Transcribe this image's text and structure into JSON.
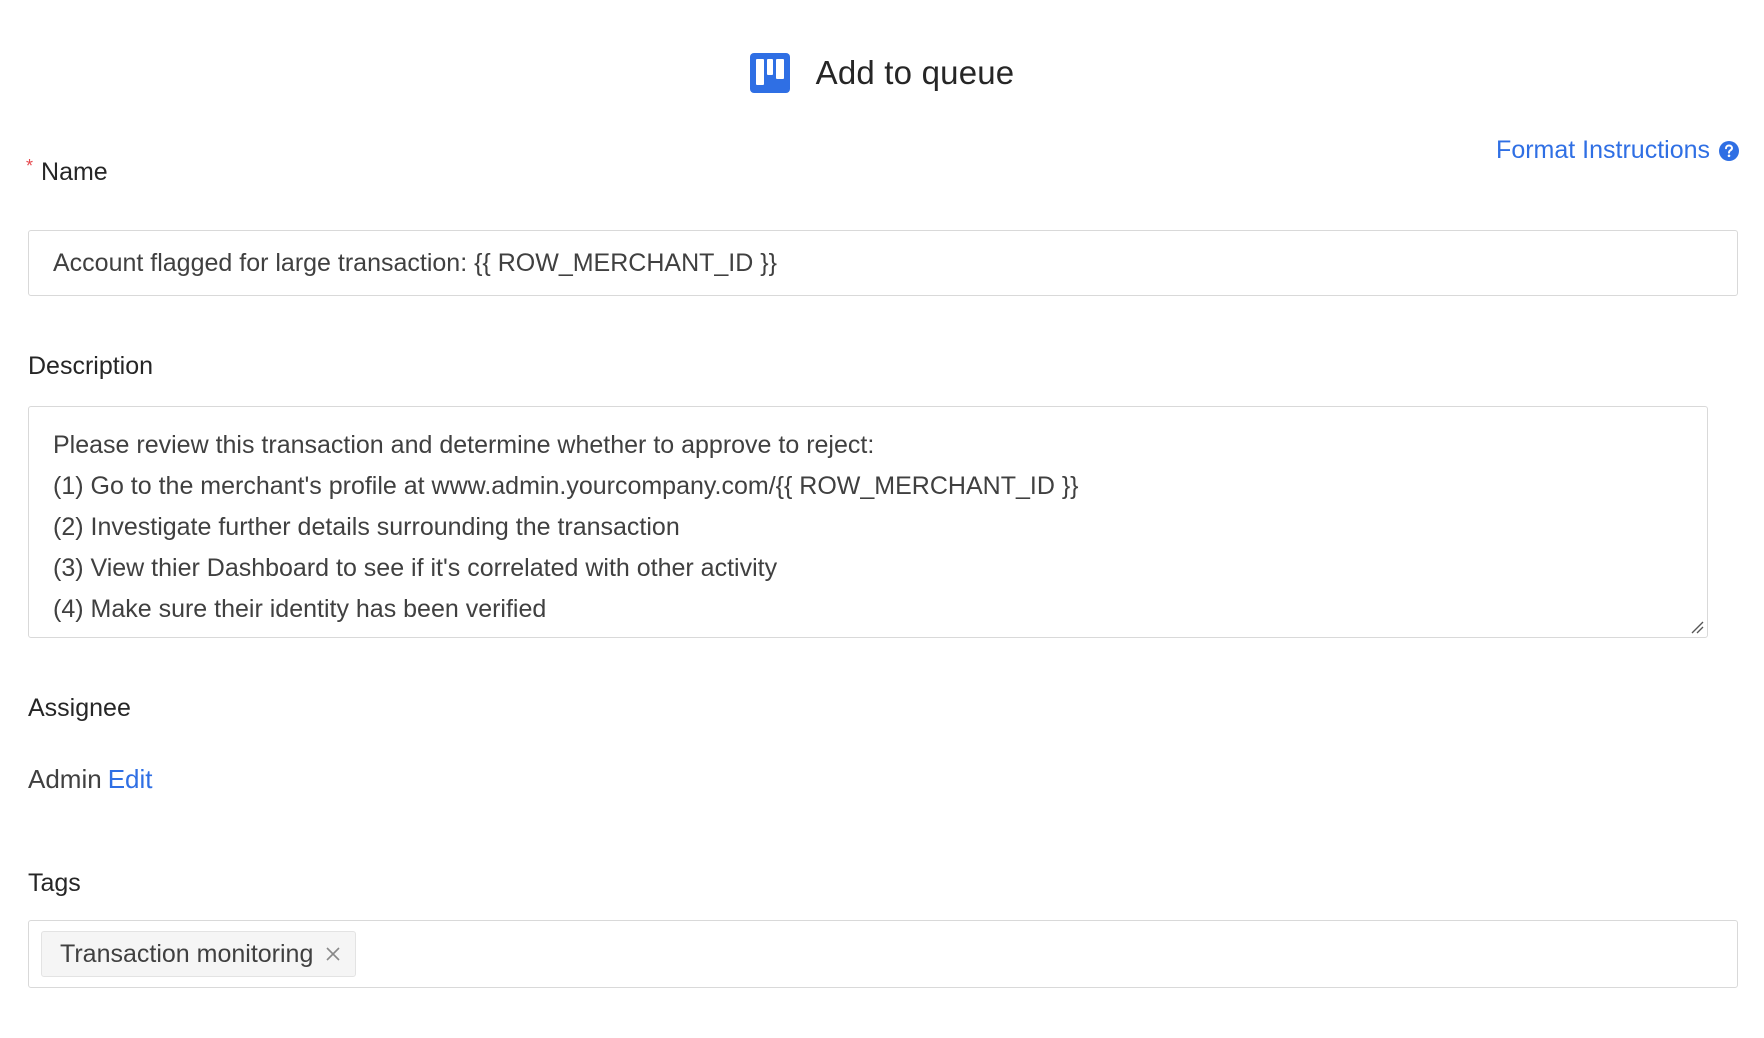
{
  "header": {
    "title": "Add to queue",
    "icon": "board-icon",
    "icon_color": "#2f6fe4"
  },
  "format_instructions": {
    "label": "Format Instructions",
    "icon": "question-circle-icon",
    "color": "#2f6fe4"
  },
  "name_field": {
    "required_marker": "*",
    "label": "Name",
    "value": "Account flagged for large transaction: {{ ROW_MERCHANT_ID }}"
  },
  "description_field": {
    "label": "Description",
    "lines": [
      "Please review this transaction and determine whether to approve to reject:",
      "(1) Go to the merchant's profile at www.admin.yourcompany.com/{{ ROW_MERCHANT_ID }}",
      "(2) Investigate further details surrounding the transaction",
      "(3) View thier Dashboard to see if it's correlated with other activity",
      "(4) Make sure their identity has been verified"
    ]
  },
  "assignee": {
    "label": "Assignee",
    "value": "Admin",
    "edit_label": "Edit"
  },
  "tags": {
    "label": "Tags",
    "items": [
      {
        "label": "Transaction monitoring",
        "close_icon": "close-icon"
      }
    ]
  },
  "colors": {
    "required": "#e5484d",
    "link": "#2f6fe4",
    "border": "#d9d9d9"
  }
}
